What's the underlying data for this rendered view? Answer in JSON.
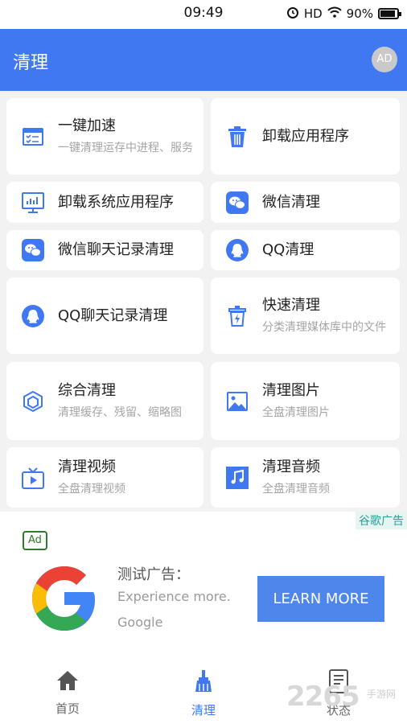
{
  "status": {
    "time": "09:49",
    "network": "HD",
    "battery": "90%"
  },
  "header": {
    "title": "清理",
    "avatar": "AD"
  },
  "cards": [
    {
      "title": "一键加速",
      "sub": "一键清理运存中进程、服务",
      "icon": "speed-boost-icon"
    },
    {
      "title": "卸载应用程序",
      "sub": "",
      "icon": "trash-icon"
    },
    {
      "title": "卸载系统应用程序",
      "sub": "",
      "icon": "monitor-chart-icon"
    },
    {
      "title": "微信清理",
      "sub": "",
      "icon": "wechat-icon"
    },
    {
      "title": "微信聊天记录清理",
      "sub": "",
      "icon": "wechat-icon"
    },
    {
      "title": "QQ清理",
      "sub": "",
      "icon": "qq-icon"
    },
    {
      "title": "QQ聊天记录清理",
      "sub": "",
      "icon": "qq-icon"
    },
    {
      "title": "快速清理",
      "sub": "分类清理媒体库中的文件",
      "icon": "quick-clean-icon"
    },
    {
      "title": "综合清理",
      "sub": "清理缓存、残留、缩略图",
      "icon": "hexagon-icon"
    },
    {
      "title": "清理图片",
      "sub": "全盘清理图片",
      "icon": "image-icon"
    },
    {
      "title": "清理视频",
      "sub": "全盘清理视频",
      "icon": "tv-icon"
    },
    {
      "title": "清理音频",
      "sub": "全盘清理音频",
      "icon": "music-icon"
    }
  ],
  "ad": {
    "tag": "谷歌广告",
    "badge": "Ad",
    "title": "测试广告：",
    "subtitle": "Experience more.",
    "brand": "Google",
    "cta": "LEARN MORE"
  },
  "nav": {
    "home": "首页",
    "clean": "清理",
    "status": "状态"
  },
  "watermark": {
    "text": "2265",
    "sub": "手游网"
  },
  "colors": {
    "brand": "#4078f2",
    "card_bg": "#ffffff",
    "page_bg": "#f2f2f2"
  }
}
